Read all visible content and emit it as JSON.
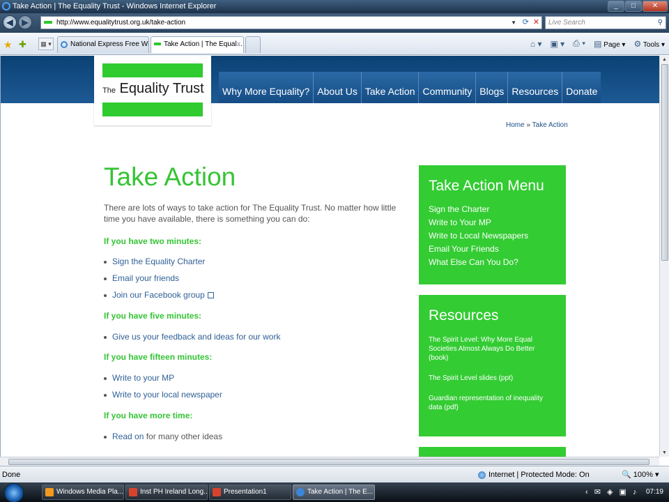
{
  "window": {
    "title": "Take Action | The Equality Trust - Windows Internet Explorer"
  },
  "address": {
    "url": "http://www.equalitytrust.org.uk/take-action",
    "search_placeholder": "Live Search"
  },
  "tabs": [
    {
      "label": "National Express Free WiFi"
    },
    {
      "label": "Take Action | The Equal..."
    }
  ],
  "commandbar": {
    "page": "Page",
    "tools": "Tools"
  },
  "site": {
    "logo": {
      "the": "The",
      "name": "Equality Trust"
    },
    "nav": [
      "Why More Equality?",
      "About Us",
      "Take Action",
      "Community",
      "Blogs",
      "Resources",
      "Donate"
    ],
    "breadcrumb": {
      "home": "Home",
      "sep": "»",
      "current": "Take Action"
    }
  },
  "main": {
    "title": "Take Action",
    "intro": "There are lots of ways to take action for The Equality Trust. No matter how little time you have available, there is something you can do:",
    "sections": [
      {
        "heading": "If you have two minutes:",
        "items": [
          "Sign the Equality Charter",
          "Email your friends",
          "Join our Facebook group"
        ]
      },
      {
        "heading": "If you have five minutes:",
        "items": [
          "Give us your feedback and ideas for our work"
        ]
      },
      {
        "heading": "If you have fifteen minutes:",
        "items": [
          "Write to your MP",
          "Write to your local newspaper"
        ]
      },
      {
        "heading": "If you have more time:",
        "items": [
          "Read on"
        ],
        "suffix": " for many other ideas"
      }
    ]
  },
  "sidebar": {
    "menu": {
      "title": "Take Action Menu",
      "items": [
        "Sign the Charter",
        "Write to Your MP",
        "Write to Local Newspapers",
        "Email Your Friends",
        "What Else Can You Do?"
      ]
    },
    "resources": {
      "title": "Resources",
      "items": [
        "The Spirit Level: Why More Equal Societies Almost Always Do Better (book)",
        "The Spirit Level slides (ppt)",
        "Guardian representation of inequality data (pdf)"
      ]
    }
  },
  "status": {
    "left": "Done",
    "zone": "Internet | Protected Mode: On",
    "zoom": "100%"
  },
  "taskbar": {
    "tasks": [
      "Windows Media Pla...",
      "Inst PH Ireland Long...",
      "Presentation1",
      "Take Action | The E..."
    ],
    "clock": "07:19"
  },
  "colors": {
    "brand_green": "#33cc33",
    "nav_blue": "#154c84",
    "link_blue": "#2f5f95"
  }
}
